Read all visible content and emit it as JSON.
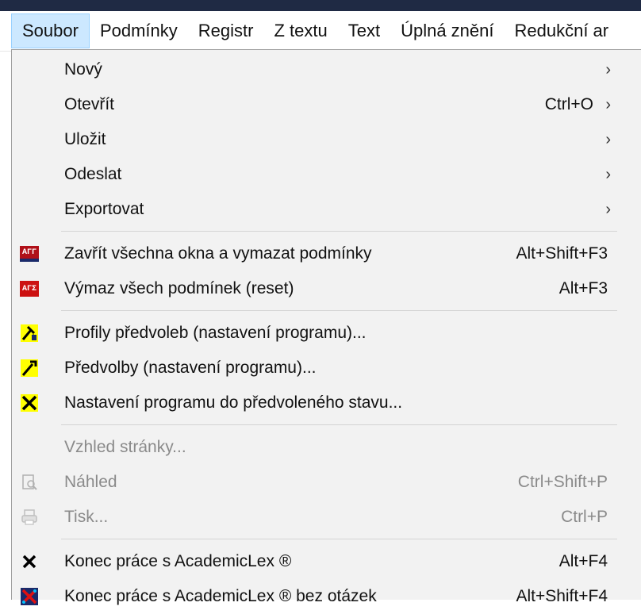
{
  "menubar": {
    "items": [
      "Soubor",
      "Podmínky",
      "Registr",
      "Z textu",
      "Text",
      "Úplná znění",
      "Redukční ar"
    ]
  },
  "menu": {
    "group1": [
      {
        "label": "Nový",
        "shortcut": "",
        "submenu": true
      },
      {
        "label": "Otevřít",
        "shortcut": "Ctrl+O",
        "submenu": true
      },
      {
        "label": "Uložit",
        "shortcut": "",
        "submenu": true
      },
      {
        "label": "Odeslat",
        "shortcut": "",
        "submenu": true
      },
      {
        "label": "Exportovat",
        "shortcut": "",
        "submenu": true
      }
    ],
    "group2": [
      {
        "label": "Zavřít všechna okna a vymazat podmínky",
        "shortcut": "Alt+Shift+F3",
        "icon": "ari-close-reset-icon",
        "icon_text": "ΑΓΓ"
      },
      {
        "label": "Výmaz všech podmínek (reset)",
        "shortcut": "Alt+F3",
        "icon": "ari-reset-icon",
        "icon_text": "ΑΓΣ"
      }
    ],
    "group3": [
      {
        "label": "Profily předvoleb (nastavení programu)...",
        "icon": "profiles-tools-icon"
      },
      {
        "label": "Předvolby (nastavení programu)...",
        "icon": "preferences-tools-icon"
      },
      {
        "label": "Nastavení programu do předvoleného stavu...",
        "icon": "reset-tools-icon"
      }
    ],
    "group4": [
      {
        "label": "Vzhled stránky...",
        "shortcut": "",
        "disabled": true
      },
      {
        "label": "Náhled",
        "shortcut": "Ctrl+Shift+P",
        "disabled": true,
        "icon": "print-preview-icon"
      },
      {
        "label": "Tisk...",
        "shortcut": "Ctrl+P",
        "disabled": true,
        "icon": "print-icon"
      }
    ],
    "group5": [
      {
        "label": "Konec práce s AcademicLex ®",
        "shortcut": "Alt+F4",
        "icon": "exit-x-icon"
      },
      {
        "label": "Konec práce s AcademicLex ® bez otázek",
        "shortcut": "Alt+Shift+F4",
        "icon": "exit-no-questions-icon"
      }
    ]
  },
  "colors": {
    "menu_bg": "#f2f2f2",
    "selected_bg": "#cce8ff",
    "disabled_text": "#8a8a8a",
    "icon_red": "#cc1111",
    "icon_yellow": "#ffff00",
    "icon_navy": "#1a2a6a"
  }
}
